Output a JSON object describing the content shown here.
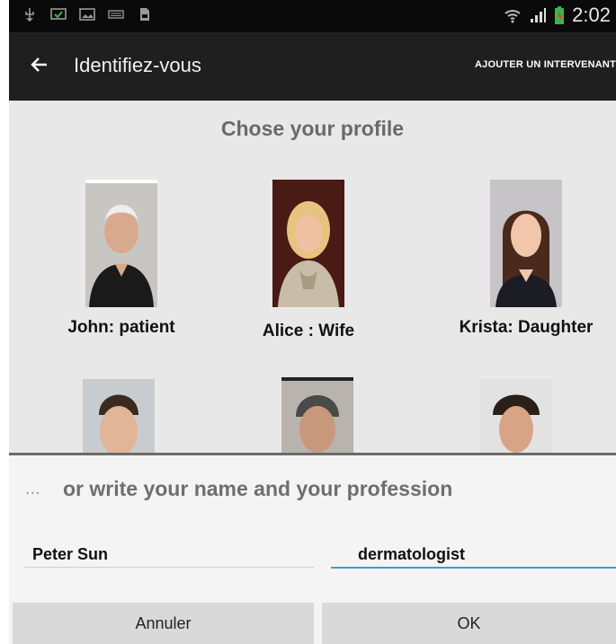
{
  "statusbar": {
    "time": "2:02",
    "left_icons": [
      "usb-icon",
      "screen-cast-icon",
      "image-icon",
      "keyboard-icon",
      "document-icon"
    ]
  },
  "actionbar": {
    "title": "Identifiez-vous",
    "action_label": "AJOUTER UN INTERVENANT"
  },
  "profiles": {
    "heading": "Chose your profile",
    "items": [
      {
        "label": "John: patient"
      },
      {
        "label": "Alice : Wife"
      },
      {
        "label": "Krista: Daughter"
      }
    ]
  },
  "form": {
    "prefix": "...",
    "heading": "or write your name and your profession",
    "name_value": "Peter Sun",
    "profession_value": "dermatologist"
  },
  "buttons": {
    "cancel": "Annuler",
    "ok": "OK"
  },
  "colors": {
    "accent": "#3e9bd1",
    "actionbar": "#1f1f1f",
    "content_bg": "#e8e8e8"
  }
}
